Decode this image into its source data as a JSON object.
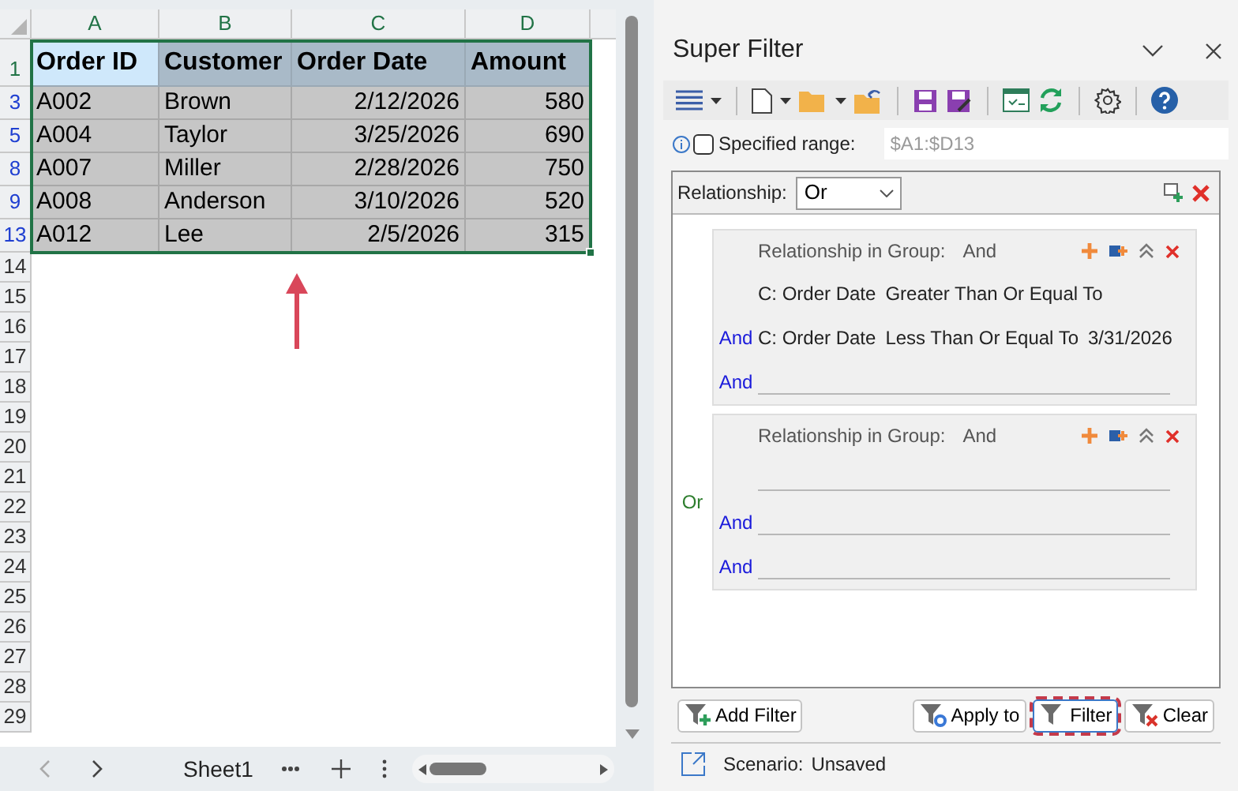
{
  "sheet": {
    "columns": [
      {
        "label": "A"
      },
      {
        "label": "B"
      },
      {
        "label": "C"
      },
      {
        "label": "D"
      }
    ],
    "header_row": {
      "number": "1",
      "cells": [
        {
          "text": "Order ID",
          "active": true
        },
        {
          "text": "Customer",
          "active": false
        },
        {
          "text": "Order Date",
          "active": false
        },
        {
          "text": "Amount",
          "active": false
        }
      ]
    },
    "rows": [
      {
        "number": "3",
        "filtered": true,
        "cells": [
          "A002",
          "Brown",
          "2/12/2026",
          "580"
        ]
      },
      {
        "number": "5",
        "filtered": true,
        "cells": [
          "A004",
          "Taylor",
          "3/25/2026",
          "690"
        ]
      },
      {
        "number": "8",
        "filtered": true,
        "cells": [
          "A007",
          "Miller",
          "2/28/2026",
          "750"
        ]
      },
      {
        "number": "9",
        "filtered": true,
        "cells": [
          "A008",
          "Anderson",
          "3/10/2026",
          "520"
        ]
      },
      {
        "number": "13",
        "filtered": true,
        "cells": [
          "A012",
          "Lee",
          "2/5/2026",
          "315"
        ]
      }
    ],
    "empty_rows": [
      "14",
      "15",
      "16",
      "17",
      "18",
      "19",
      "20",
      "21",
      "22",
      "23",
      "24",
      "25",
      "26",
      "27",
      "28",
      "29"
    ],
    "sheet_tabs": [
      {
        "label": "Sheet1",
        "selected": true
      }
    ]
  },
  "panel": {
    "title": "Super Filter",
    "specified_range": {
      "label": "Specified range:",
      "checked": false,
      "placeholder": "$A1:$D13"
    },
    "relationship": {
      "label": "Relationship:",
      "value": "Or"
    },
    "groups": [
      {
        "label": "Relationship in Group:",
        "value": "And",
        "conditions": [
          {
            "kind": "condition",
            "field": "C: Order Date",
            "operator": "Greater Than Or Equal To"
          },
          {
            "kind": "condition",
            "connector": "And",
            "field": "C: Order Date",
            "operator": "Less Than Or Equal To",
            "value": "3/31/2026"
          },
          {
            "kind": "empty",
            "connector": "And"
          }
        ]
      },
      {
        "connector": "Or",
        "label": "Relationship in Group:",
        "value": "And",
        "conditions": [
          {
            "kind": "empty"
          },
          {
            "kind": "empty",
            "connector": "And"
          },
          {
            "kind": "empty",
            "connector": "And"
          }
        ]
      }
    ],
    "buttons": [
      {
        "kind": "add",
        "label": "Add Filter",
        "focused": false
      },
      {
        "kind": "apply",
        "label": "Apply to",
        "focused": false
      },
      {
        "kind": "filter",
        "label": "Filter",
        "focused": true
      },
      {
        "kind": "clear",
        "label": "Clear",
        "focused": false
      }
    ],
    "scenario": {
      "label": "Scenario:",
      "value": "Unsaved"
    }
  }
}
